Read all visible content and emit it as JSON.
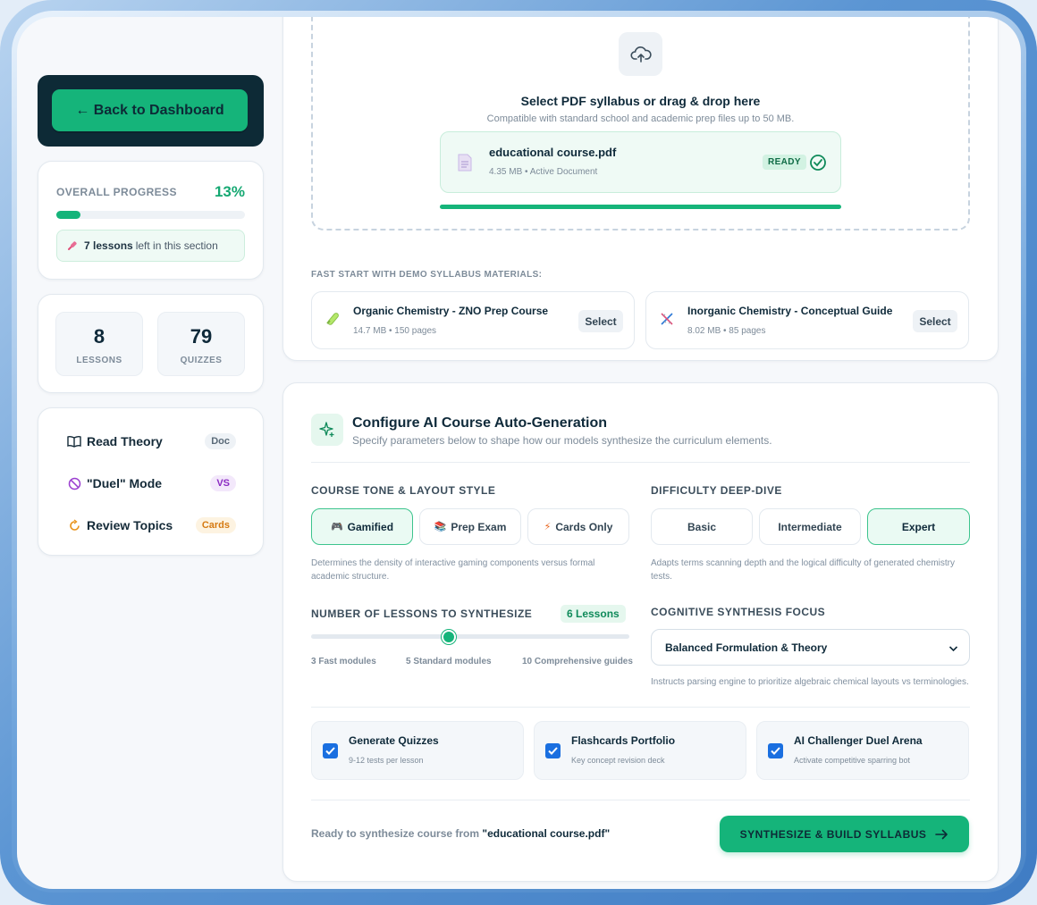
{
  "sidebar": {
    "back_label": "← Back to Dashboard",
    "progress": {
      "label": "OVERALL PROGRESS",
      "percent_text": "13%",
      "percent_value": 13,
      "lessons_bold": "7 lessons",
      "lessons_rest": "left in this section"
    },
    "stats": [
      {
        "value": "8",
        "label": "LESSONS"
      },
      {
        "value": "79",
        "label": "QUIZZES"
      }
    ],
    "modes": [
      {
        "label": "Read Theory",
        "badge": "Doc",
        "icon": "book-icon",
        "badge_bg": "#eef2f6",
        "badge_color": "#5a6a78"
      },
      {
        "label": "\"Duel\" Mode",
        "badge": "VS",
        "icon": "ban-icon",
        "badge_bg": "#f3e8fb",
        "badge_color": "#8a2bc2"
      },
      {
        "label": "Review Topics",
        "badge": "Cards",
        "icon": "refresh-icon",
        "badge_bg": "#fdf3e1",
        "badge_color": "#d57a12"
      }
    ]
  },
  "upload": {
    "title": "Select PDF syllabus or drag & drop here",
    "subtitle": "Compatible with standard school and academic prep files up to 50 MB.",
    "file_name": "educational course.pdf",
    "file_meta": "4.35 MB • Active Document",
    "status": "READY",
    "upload_progress": 1.0,
    "demo_label": "FAST START WITH DEMO SYLLABUS MATERIALS:",
    "demos": [
      {
        "title": "Organic Chemistry - ZNO Prep Course",
        "meta": "14.7 MB • 150 pages",
        "select": "Select",
        "icon": "test-tube-icon"
      },
      {
        "title": "Inorganic Chemistry - Conceptual Guide",
        "meta": "8.02 MB • 85 pages",
        "select": "Select",
        "icon": "dna-icon"
      }
    ]
  },
  "config": {
    "title": "Configure AI Course Auto-Generation",
    "subtitle": "Specify parameters below to shape how our models synthesize the curriculum elements.",
    "tone_label": "COURSE TONE & LAYOUT STYLE",
    "tone_options": [
      {
        "label": "Gamified",
        "icon": "🎮",
        "active": true
      },
      {
        "label": "Prep Exam",
        "icon": "📚",
        "active": false
      },
      {
        "label": "Cards Only",
        "icon": "⚡",
        "active": false
      }
    ],
    "tone_help": "Determines the density of interactive gaming components versus formal academic structure.",
    "difficulty_label": "DIFFICULTY DEEP-DIVE",
    "difficulty_options": [
      {
        "label": "Basic",
        "active": false
      },
      {
        "label": "Intermediate",
        "active": false
      },
      {
        "label": "Expert",
        "active": true
      }
    ],
    "difficulty_help": "Adapts terms scanning depth and the logical difficulty of generated chemistry tests.",
    "lessons_label": "NUMBER OF LESSONS TO SYNTHESIZE",
    "lessons_badge": "6 Lessons",
    "lessons_value": 6,
    "lessons_ticks": [
      "3 Fast modules",
      "5 Standard modules",
      "10 Comprehensive guides"
    ],
    "focus_label": "COGNITIVE SYNTHESIS FOCUS",
    "focus_value": "Balanced Formulation & Theory",
    "focus_help": "Instructs parsing engine to prioritize algebraic chemical layouts vs terminologies.",
    "features": [
      {
        "title": "Generate Quizzes",
        "sub": "9-12 tests per lesson",
        "checked": true
      },
      {
        "title": "Flashcards Portfolio",
        "sub": "Key concept revision deck",
        "checked": true
      },
      {
        "title": "AI Challenger Duel Arena",
        "sub": "Activate competitive sparring bot",
        "checked": true
      }
    ],
    "ready_prefix": "Ready to synthesize course from",
    "ready_file": "\"educational course.pdf\"",
    "build_label": "SYNTHESIZE & BUILD SYLLABUS"
  },
  "colors": {
    "accent": "#15b47a",
    "dark": "#0d2a36",
    "checkbox": "#1a6fe0"
  }
}
